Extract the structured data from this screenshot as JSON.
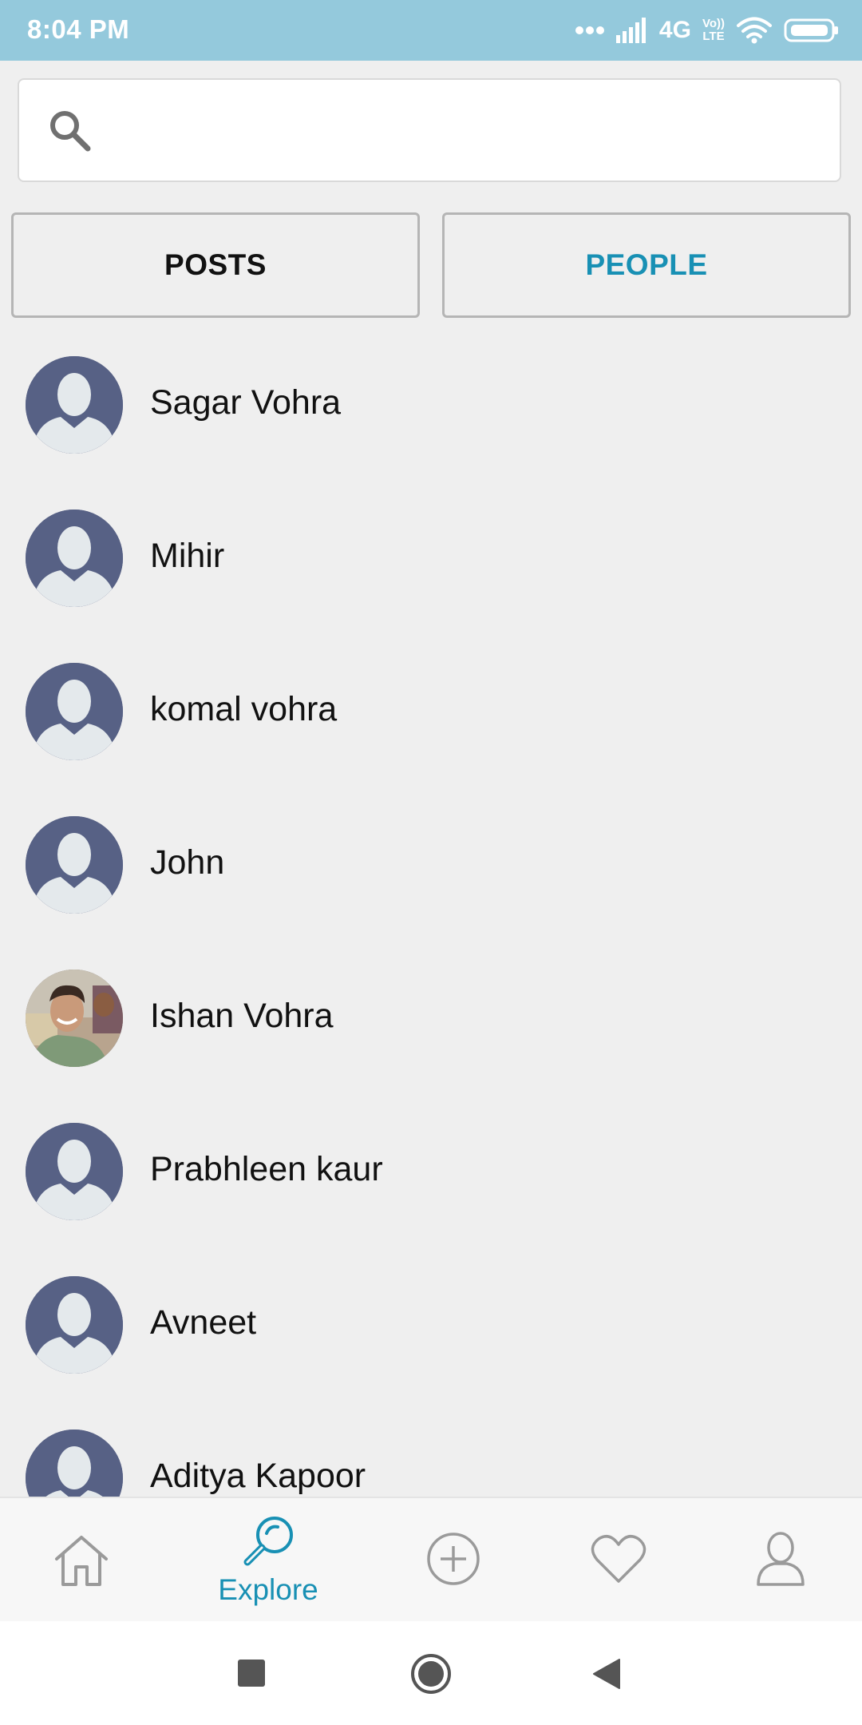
{
  "status_bar": {
    "time": "8:04 PM",
    "network_label": "4G",
    "volte_line1": "Vo))",
    "volte_line2": "LTE",
    "icons": [
      "more-dots-icon",
      "signal-icon",
      "network-label",
      "volte-icon",
      "wifi-icon",
      "battery-icon"
    ]
  },
  "search": {
    "placeholder": "",
    "value": "",
    "icon": "search-icon"
  },
  "tabs": [
    {
      "label": "POSTS",
      "active": false
    },
    {
      "label": "PEOPLE",
      "active": true
    }
  ],
  "people": [
    {
      "name": "Sagar Vohra",
      "avatar": "default"
    },
    {
      "name": "Mihir",
      "avatar": "default"
    },
    {
      "name": "komal vohra",
      "avatar": "default"
    },
    {
      "name": "John",
      "avatar": "default"
    },
    {
      "name": "Ishan Vohra",
      "avatar": "photo"
    },
    {
      "name": "Prabhleen kaur",
      "avatar": "default"
    },
    {
      "name": "Avneet",
      "avatar": "default"
    },
    {
      "name": "Aditya Kapoor",
      "avatar": "default"
    }
  ],
  "bottom_nav": {
    "items": [
      {
        "icon": "home-icon",
        "label": "",
        "active": false
      },
      {
        "icon": "explore-icon",
        "label": "Explore",
        "active": true
      },
      {
        "icon": "add-icon",
        "label": "",
        "active": false
      },
      {
        "icon": "heart-icon",
        "label": "",
        "active": false
      },
      {
        "icon": "profile-icon",
        "label": "",
        "active": false
      }
    ]
  },
  "system_nav": {
    "icons": [
      "recents-icon",
      "home-circle-icon",
      "back-icon"
    ]
  },
  "colors": {
    "status_bar": "#94c9dc",
    "accent": "#1890b4",
    "background": "#efefef",
    "avatar_default": "#576185"
  }
}
